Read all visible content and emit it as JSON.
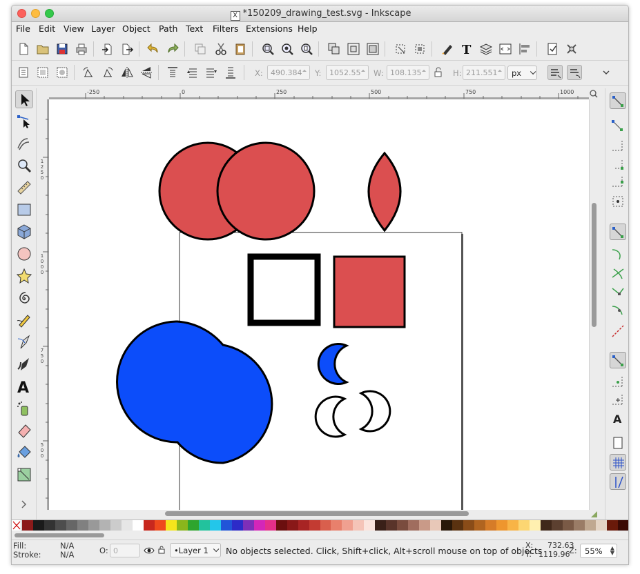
{
  "window": {
    "title": "*150209_drawing_test.svg - Inkscape",
    "title_icon": "X"
  },
  "menu": [
    "File",
    "Edit",
    "View",
    "Layer",
    "Object",
    "Path",
    "Text",
    "Filters",
    "Extensions",
    "Help"
  ],
  "controls": {
    "x_label": "X:",
    "x_value": "490.384",
    "y_label": "Y:",
    "y_value": "1052.55",
    "w_label": "W:",
    "w_value": "108.135",
    "h_label": "H:",
    "h_value": "211.551",
    "unit": "px"
  },
  "rulers": {
    "h_ticks": [
      "-250",
      "0",
      "250",
      "500",
      "750",
      "1000"
    ],
    "v_ticks": [
      "1250",
      "1000",
      "750",
      "500"
    ]
  },
  "canvas": {
    "red_color": "#db4f50",
    "blue_color": "#0c4dfa",
    "stroke_color": "#000000"
  },
  "palette": [
    "#8b1a1a",
    "#1a1a1a",
    "#333333",
    "#4d4d4d",
    "#666666",
    "#808080",
    "#999999",
    "#b3b3b3",
    "#cccccc",
    "#e6e6e6",
    "#ffffff",
    "#c8281e",
    "#ef4a1c",
    "#f5e51c",
    "#8ab61c",
    "#2ea52e",
    "#22c29d",
    "#23c6ea",
    "#2155d8",
    "#2d2bc8",
    "#7e2fb8",
    "#d426b9",
    "#e52f8a",
    "#6b0f0f",
    "#891818",
    "#a82424",
    "#c33b32",
    "#d95f4d",
    "#e8806c",
    "#f0a090",
    "#f5c4b8",
    "#fbe4dd",
    "#3a2018",
    "#59342a",
    "#7a4c3e",
    "#a06d5e",
    "#c99a88",
    "#e8c8b8",
    "#2a1808",
    "#5a3210",
    "#8a4c18",
    "#b06420",
    "#d67c28",
    "#ee962e",
    "#f8b446",
    "#fcd672",
    "#fff0b0",
    "#40281a",
    "#5c4030",
    "#7a5a46",
    "#9a7c66",
    "#c0a890",
    "#e4d4c4",
    "#6a1a0a",
    "#3a0a04"
  ],
  "status": {
    "fill_label": "Fill:",
    "fill_value": "N/A",
    "stroke_label": "Stroke:",
    "stroke_value": "N/A",
    "opacity_label": "O:",
    "opacity_value": "0",
    "layer": "•Layer 1",
    "message": "No objects selected. Click, Shift+click, Alt+scroll mouse on top of objects",
    "cursor_x_label": "X:",
    "cursor_x": "732.63",
    "cursor_y_label": "Y:",
    "cursor_y": "1119.96",
    "zoom_label": "Z:",
    "zoom": "55%"
  }
}
